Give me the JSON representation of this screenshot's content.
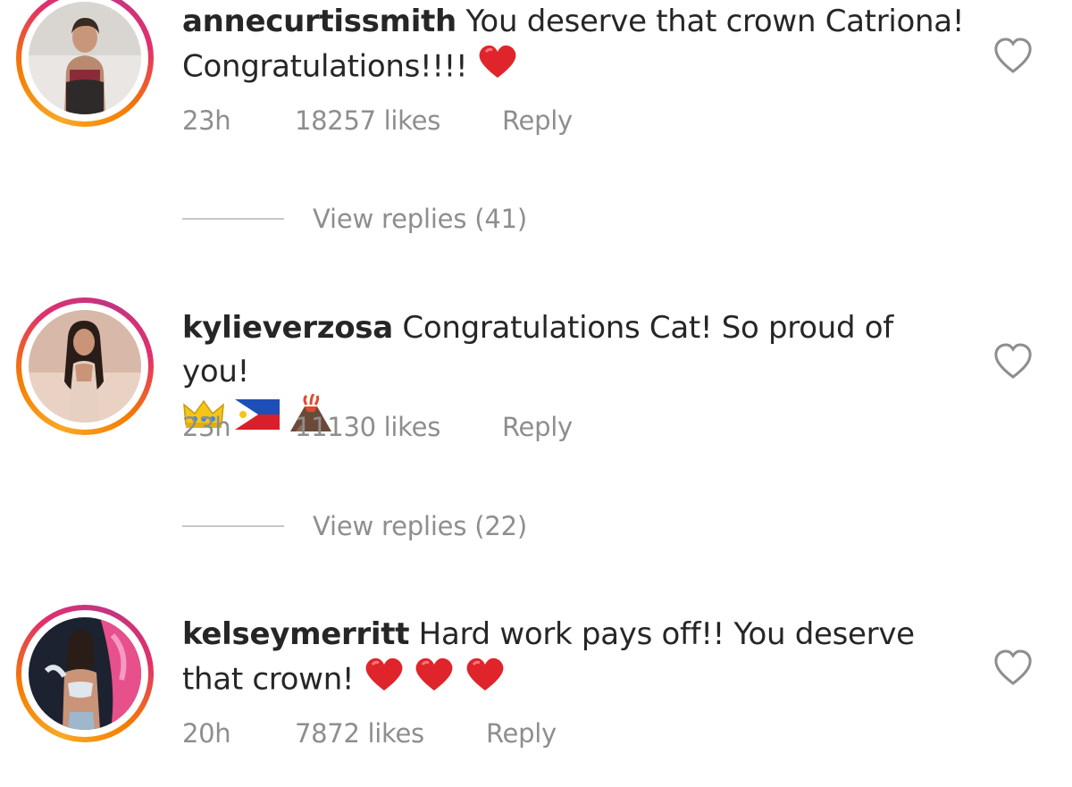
{
  "comments": [
    {
      "username": "annecurtissmith",
      "text": "You deserve that crown Catriona! Congratulations!!!!",
      "emojis": [
        "red-heart"
      ],
      "time": "23h",
      "likes": "18257 likes",
      "reply": "Reply",
      "view_replies": "View replies (41)"
    },
    {
      "username": "kylieverzosa",
      "text": "Congratulations Cat! So proud of you!",
      "emojis": [
        "crown",
        "philippines-flag",
        "volcano"
      ],
      "time": "23h",
      "likes": "11130 likes",
      "reply": "Reply",
      "view_replies": "View replies (22)"
    },
    {
      "username": "kelseymerritt",
      "text": "Hard work pays off!! You deserve that crown!",
      "emojis": [
        "red-heart",
        "red-heart",
        "red-heart"
      ],
      "time": "20h",
      "likes": "7872 likes",
      "reply": "Reply"
    }
  ],
  "colors": {
    "meta_text": "#8e8e8e",
    "heart_emoji": "#e0242b",
    "ring_start": "#f9a825",
    "ring_end": "#c13584"
  }
}
